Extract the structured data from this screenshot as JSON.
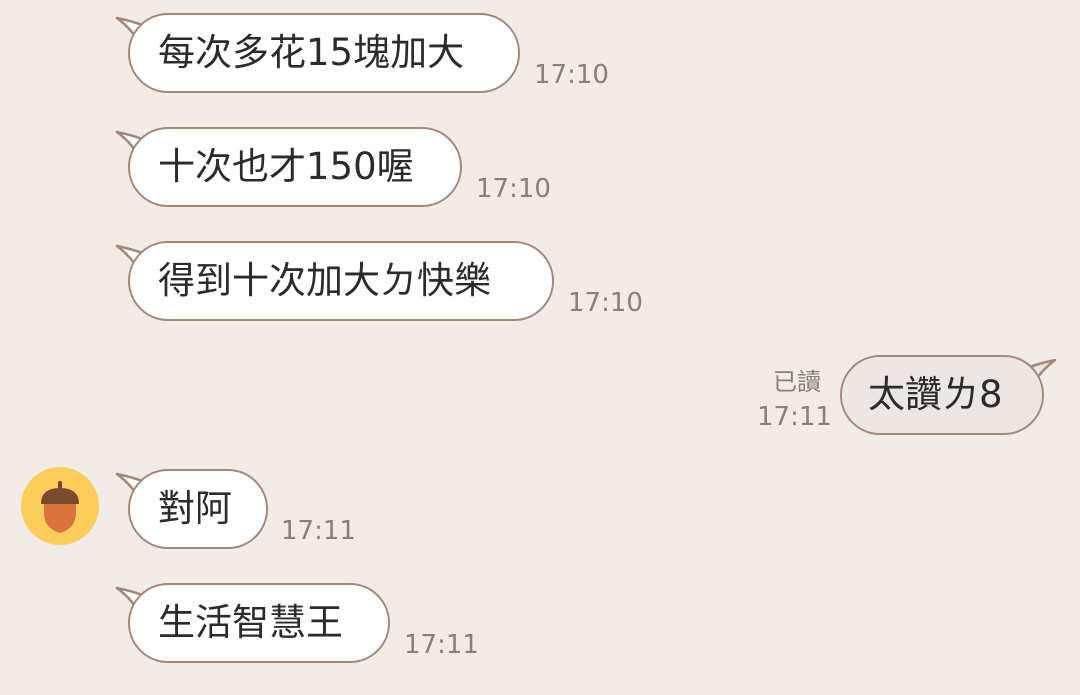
{
  "messages": [
    {
      "side": "in",
      "text": "每次多花15塊加大",
      "time": "17:10"
    },
    {
      "side": "in",
      "text": "十次也才150喔",
      "time": "17:10"
    },
    {
      "side": "in",
      "text": "得到十次加大ㄉ快樂",
      "time": "17:10"
    },
    {
      "side": "out",
      "text": "太讚ㄌ8",
      "time": "17:11",
      "status": "已讀"
    },
    {
      "side": "in",
      "text": "對阿",
      "time": "17:11"
    },
    {
      "side": "in",
      "text": "生活智慧王",
      "time": "17:11"
    }
  ],
  "icons": {
    "avatar": "acorn-icon"
  },
  "colors": {
    "background": "#f1ece6",
    "bubble_border": "#a3887a",
    "incoming_bubble": "#ffffff",
    "outgoing_bubble": "#ede7e3",
    "time_text": "#8b7e75",
    "avatar_bg": "#fccd5b",
    "acorn_cap": "#7a4a2e",
    "acorn_body": "#d9733f"
  }
}
